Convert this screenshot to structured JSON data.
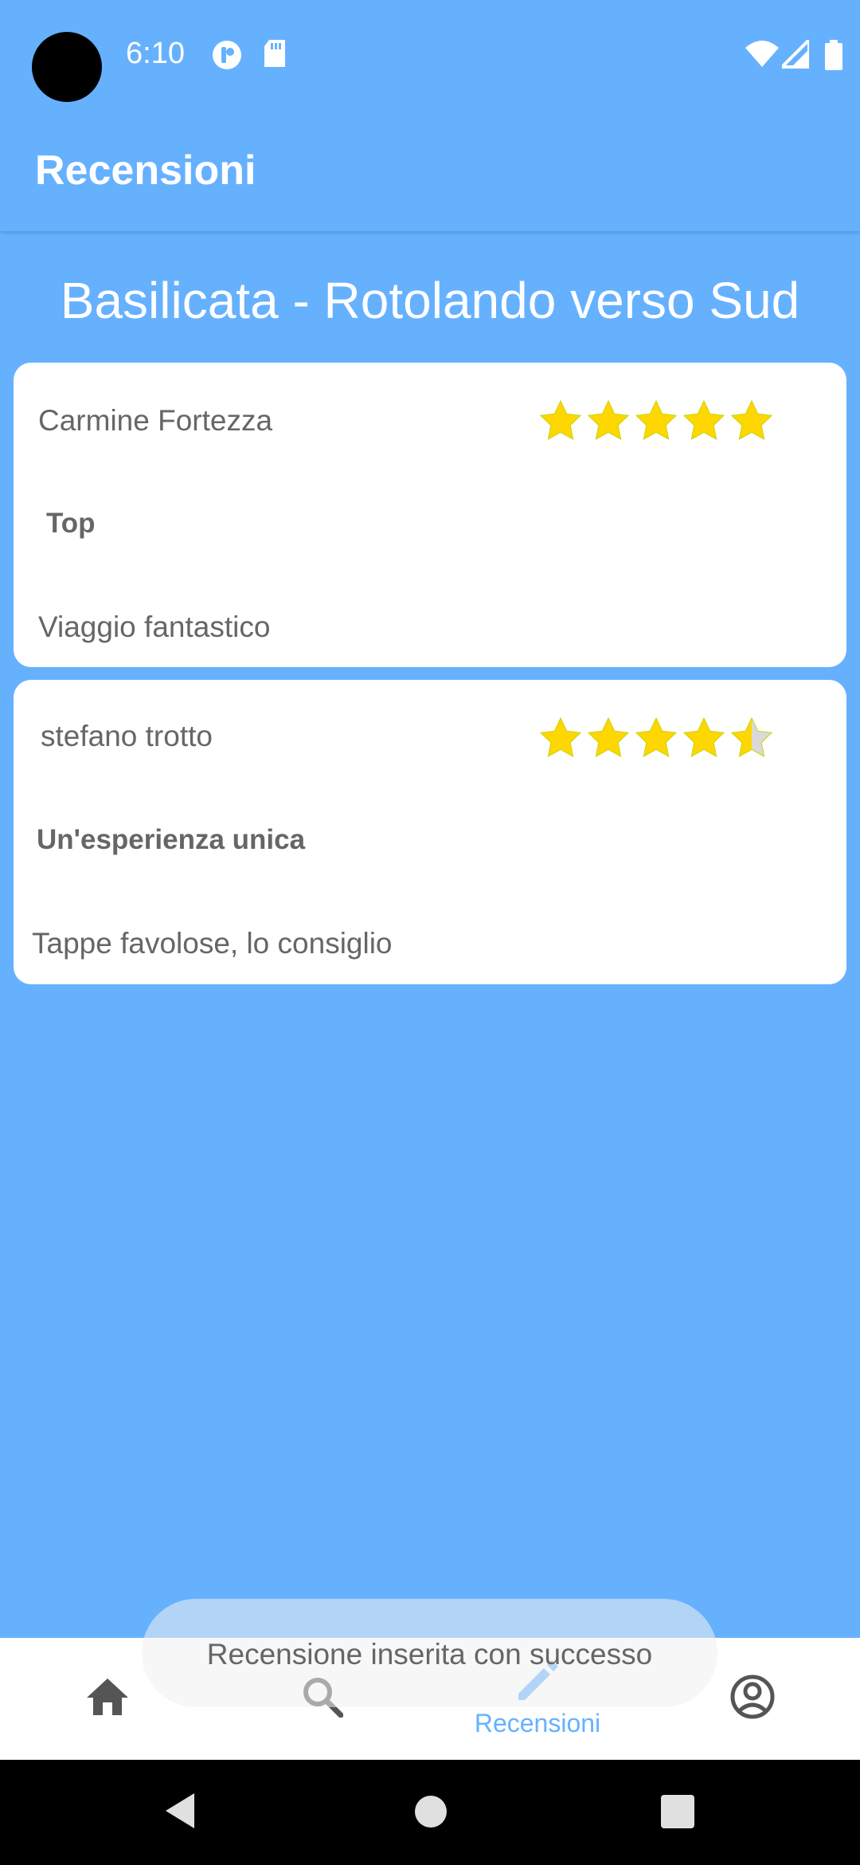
{
  "status_bar": {
    "time": "6:10",
    "icons": [
      "app-icon",
      "sd-card-icon",
      "wifi-icon",
      "signal-icon",
      "battery-icon"
    ]
  },
  "app_bar": {
    "title": "Recensioni"
  },
  "tour": {
    "title": "Basilicata - Rotolando verso Sud"
  },
  "reviews": [
    {
      "author": "Carmine Fortezza",
      "rating": 5,
      "title": "Top",
      "body": "Viaggio fantastico"
    },
    {
      "author": "stefano trotto",
      "rating": 4.5,
      "title": "Un'esperienza unica",
      "body": "Tappe favolose, lo consiglio"
    }
  ],
  "snackbar": {
    "message": "Recensione inserita con successo"
  },
  "bottom_nav": {
    "items": [
      {
        "icon": "home-icon",
        "label": ""
      },
      {
        "icon": "search-icon",
        "label": ""
      },
      {
        "icon": "pencil-icon",
        "label": "Recensioni",
        "active": true
      },
      {
        "icon": "account-icon",
        "label": ""
      }
    ]
  },
  "colors": {
    "primary": "#66b1fe",
    "star": "#ffd700",
    "star_empty": "#d9d9d9",
    "text": "#666666"
  }
}
